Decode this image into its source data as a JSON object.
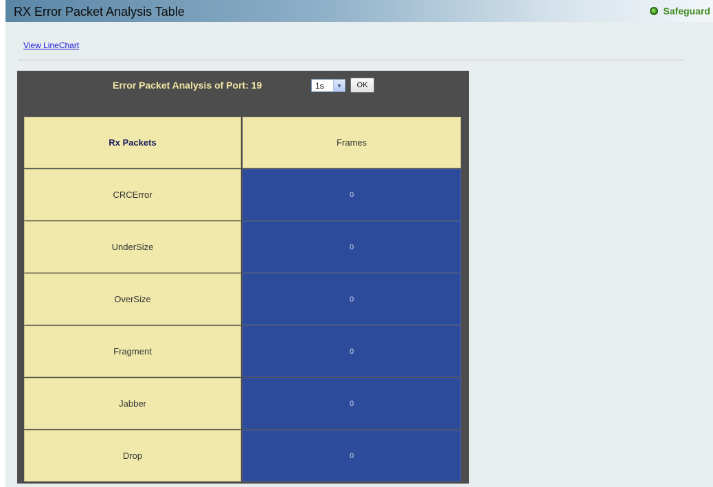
{
  "page": {
    "title": "RX Error Packet Analysis Table",
    "status": {
      "label": "Safeguard",
      "icon": "status-dot-icon"
    },
    "link_label": "View LineChart"
  },
  "panel": {
    "title": "Error Packet Analysis of Port: 19",
    "interval": {
      "selected": "1s"
    },
    "ok_label": "OK"
  },
  "table": {
    "headers": [
      "Rx Packets",
      "Frames"
    ],
    "rows": [
      {
        "label": "CRCError",
        "value": "0"
      },
      {
        "label": "UnderSize",
        "value": "0"
      },
      {
        "label": "OverSize",
        "value": "0"
      },
      {
        "label": "Fragment",
        "value": "0"
      },
      {
        "label": "Jabber",
        "value": "0"
      },
      {
        "label": "Drop",
        "value": "0"
      }
    ]
  },
  "colors": {
    "label_cell": "#f0e9ab",
    "value_cell": "#2d4b9b",
    "panel": "#4d4d4d",
    "panel_title": "#f2e6a4",
    "safeguard": "#3f8a22"
  }
}
